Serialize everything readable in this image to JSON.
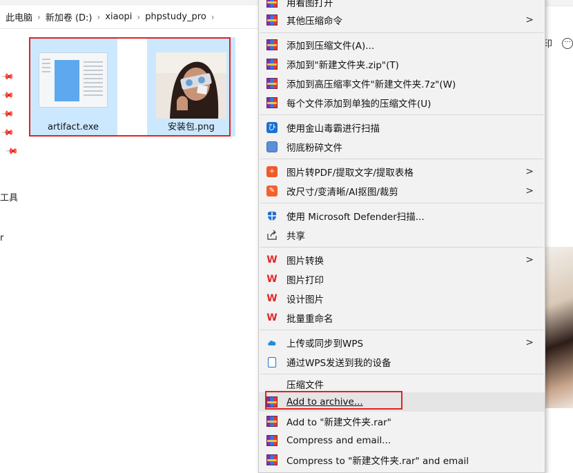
{
  "breadcrumb": {
    "items": [
      "此电脑",
      "新加卷 (D:)",
      "xiaopi",
      "phpstudy_pro"
    ]
  },
  "nav_fragments": [
    "工具",
    "r"
  ],
  "right_fragments": {
    "print_label": "印",
    "more_icon": "···"
  },
  "files": [
    {
      "name": "artifact.exe",
      "icon": "exe-window-thumbnail"
    },
    {
      "name": "安装包.png",
      "icon": "photo-thumbnail"
    }
  ],
  "context_menu": {
    "items": [
      {
        "label": "用看图打开",
        "icon": "winrar-icon",
        "submenu": false
      },
      {
        "label": "其他压缩命令",
        "icon": "winrar-icon",
        "submenu": true
      },
      {
        "label": "添加到压缩文件(A)...",
        "icon": "winrar-icon",
        "submenu": false
      },
      {
        "label": "添加到\"新建文件夹.zip\"(T)",
        "icon": "winrar-icon",
        "submenu": false
      },
      {
        "label": "添加到高压缩率文件\"新建文件夹.7z\"(W)",
        "icon": "winrar-icon",
        "submenu": false
      },
      {
        "label": "每个文件添加到单独的压缩文件(U)",
        "icon": "winrar-icon",
        "submenu": false
      },
      {
        "label": "使用金山毒霸进行扫描",
        "icon": "antivirus-icon",
        "submenu": false
      },
      {
        "label": "彻底粉碎文件",
        "icon": "shredder-icon",
        "submenu": false
      },
      {
        "label": "图片转PDF/提取文字/提取表格",
        "icon": "pdf-convert-icon",
        "submenu": true
      },
      {
        "label": "改尺寸/变清晰/AI抠图/裁剪",
        "icon": "image-edit-icon",
        "submenu": true
      },
      {
        "label": "使用 Microsoft Defender扫描...",
        "icon": "defender-shield-icon",
        "submenu": false
      },
      {
        "label": "共享",
        "icon": "share-icon",
        "submenu": false
      },
      {
        "label": "图片转换",
        "icon": "wps-icon",
        "submenu": true
      },
      {
        "label": "图片打印",
        "icon": "wps-icon",
        "submenu": false
      },
      {
        "label": "设计图片",
        "icon": "wps-icon",
        "submenu": false
      },
      {
        "label": "批量重命名",
        "icon": "wps-icon",
        "submenu": false
      },
      {
        "label": "上传或同步到WPS",
        "icon": "cloud-icon",
        "submenu": true
      },
      {
        "label": "通过WPS发送到我的设备",
        "icon": "device-icon",
        "submenu": false
      },
      {
        "label": "压缩文件",
        "icon": "",
        "submenu": false
      },
      {
        "label": "Add to archive...",
        "icon": "winrar-icon",
        "submenu": false
      },
      {
        "label": "Add to \"新建文件夹.rar\"",
        "icon": "winrar-icon",
        "submenu": false
      },
      {
        "label": "Compress and email...",
        "icon": "winrar-icon",
        "submenu": false
      },
      {
        "label": "Compress to \"新建文件夹.rar\" and email",
        "icon": "winrar-icon",
        "submenu": false
      }
    ]
  },
  "colors": {
    "selection": "#cce8ff",
    "highlight_box": "#e02020",
    "menu_bg": "#f2f2f2",
    "wps_red": "#e02b2b",
    "defender_blue": "#1f6fd1"
  }
}
